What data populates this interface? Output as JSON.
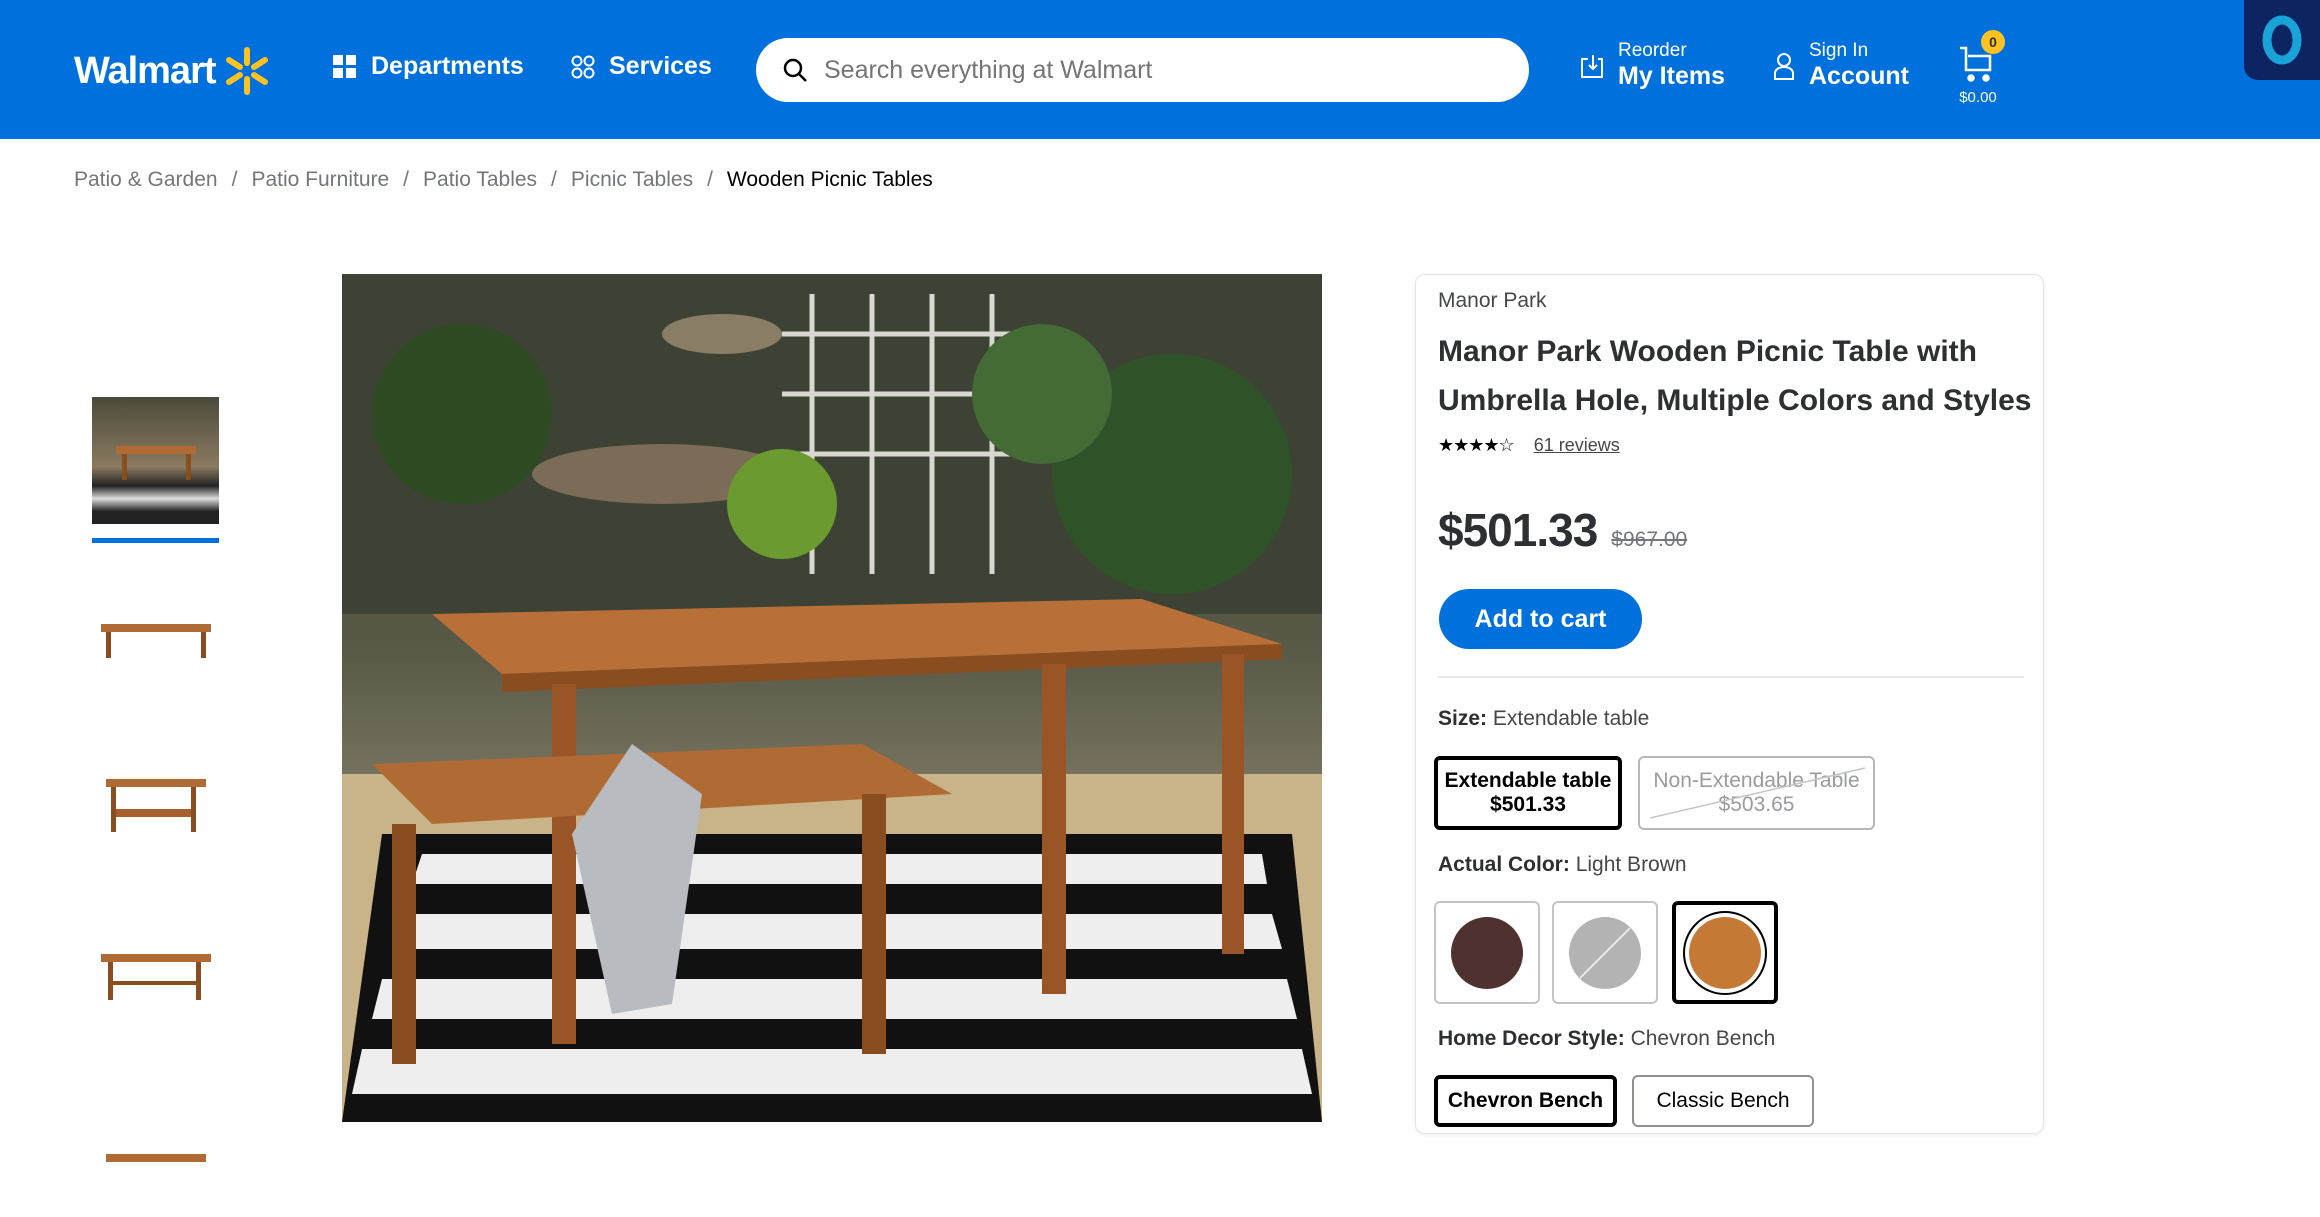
{
  "header": {
    "logo": "Walmart",
    "departments": "Departments",
    "services": "Services",
    "search_placeholder": "Search everything at Walmart",
    "reorder_small": "Reorder",
    "reorder_big": "My Items",
    "signin_small": "Sign In",
    "signin_big": "Account",
    "cart_count": "0",
    "cart_total": "$0.00",
    "brand_color": "#0071dc",
    "spark_color": "#ffc220"
  },
  "breadcrumb": [
    "Patio & Garden",
    "Patio Furniture",
    "Patio Tables",
    "Picnic Tables",
    "Wooden Picnic Tables"
  ],
  "product": {
    "brand": "Manor Park",
    "title_line1": "Manor Park Wooden Picnic Table with",
    "title_line2": "Umbrella Hole, Multiple Colors and Styles",
    "rating": 4,
    "rating_max": 5,
    "reviews": "61 reviews",
    "price": "$501.33",
    "was_price": "$967.00",
    "add_to_cart": "Add to cart",
    "size": {
      "label": "Size:",
      "value": "Extendable table",
      "options": [
        {
          "name": "Extendable table",
          "price": "$501.33",
          "selected": true
        },
        {
          "name": "Non-Extendable Table",
          "price": "$503.65",
          "unavailable": true
        }
      ]
    },
    "color": {
      "label": "Actual Color:",
      "value": "Light Brown",
      "swatches": [
        {
          "color": "#4f3230"
        },
        {
          "color": "#b3b3b3",
          "unavailable": true
        },
        {
          "color": "#c47a35",
          "selected": true
        }
      ]
    },
    "style": {
      "label": "Home Decor Style:",
      "value": "Chevron Bench",
      "options": [
        {
          "name": "Chevron Bench",
          "selected": true
        },
        {
          "name": "Classic Bench"
        }
      ]
    }
  }
}
